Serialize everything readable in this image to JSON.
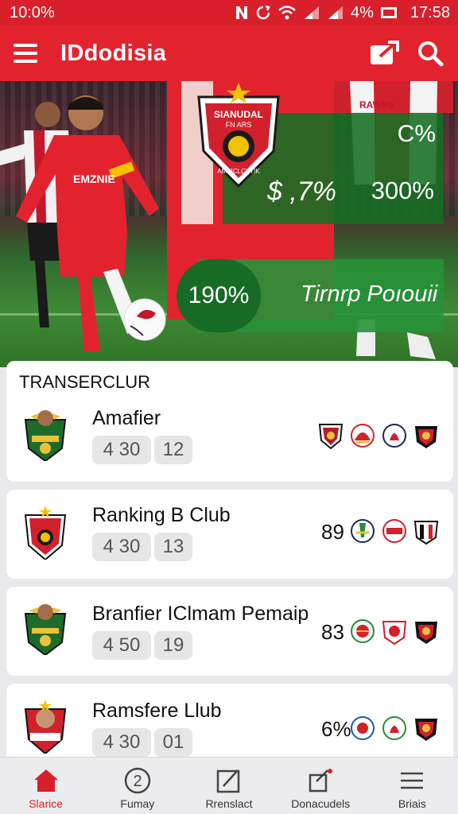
{
  "status": {
    "left": "10:0%",
    "battery": "4%",
    "time": "17:58"
  },
  "app": {
    "title": "IDdodisia"
  },
  "hero": {
    "crest_line1": "SIANUDAL",
    "crest_line2": "FN ARS",
    "crest_line3": "AMEICLCKTIK",
    "jersey_text": "EMZNIE",
    "stat_c": "C%",
    "stat_dollar": "$ ,7%",
    "stat_300": "300%",
    "stat_190": "190%",
    "stat_label": "Tirnrp Poıouii"
  },
  "section": {
    "title": "TRANSERCLUR"
  },
  "cards": [
    {
      "name": "Amafier",
      "pill1": "4 30",
      "pill2": "12",
      "score": ""
    },
    {
      "name": "Ranking B Club",
      "pill1": "4 30",
      "pill2": "13",
      "score": "89"
    },
    {
      "name": "Branfier IClmam Pemaip",
      "pill1": "4 50",
      "pill2": "19",
      "score": "83"
    },
    {
      "name": "Ramsfere Llub",
      "pill1": "4 30",
      "pill2": "01",
      "score": "6%"
    }
  ],
  "nav": {
    "items": [
      {
        "label": "Slarice",
        "icon": "home-icon"
      },
      {
        "label": "Fumay",
        "icon": "number-two-icon"
      },
      {
        "label": "Rrenslact",
        "icon": "edit-icon"
      },
      {
        "label": "Donacudels",
        "icon": "share-icon"
      },
      {
        "label": "Briais",
        "icon": "menu-icon"
      }
    ]
  },
  "colors": {
    "primary": "#e2232e",
    "status_bar": "#d81f2a",
    "panel_green": "#146e23",
    "circle_green": "#176b25"
  }
}
